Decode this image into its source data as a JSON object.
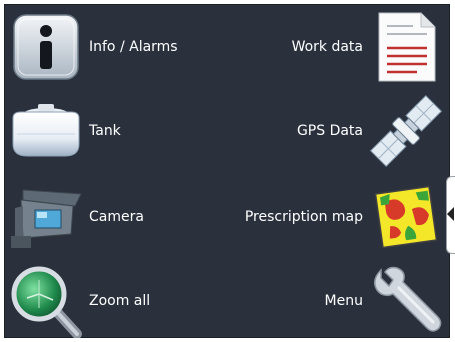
{
  "menu": {
    "left": [
      {
        "label": "Info / Alarms",
        "icon": "info-icon"
      },
      {
        "label": "Tank",
        "icon": "tank-icon"
      },
      {
        "label": "Camera",
        "icon": "camera-icon"
      },
      {
        "label": "Zoom all",
        "icon": "magnifier-icon"
      }
    ],
    "right": [
      {
        "label": "Work data",
        "icon": "document-icon"
      },
      {
        "label": "GPS Data",
        "icon": "satellite-icon"
      },
      {
        "label": "Prescription map",
        "icon": "map-icon"
      },
      {
        "label": "Menu",
        "icon": "wrench-icon"
      }
    ]
  },
  "side_tab": {
    "icon": "chevron-left-icon"
  },
  "colors": {
    "background": "#2a313d",
    "text": "#ffffff"
  }
}
